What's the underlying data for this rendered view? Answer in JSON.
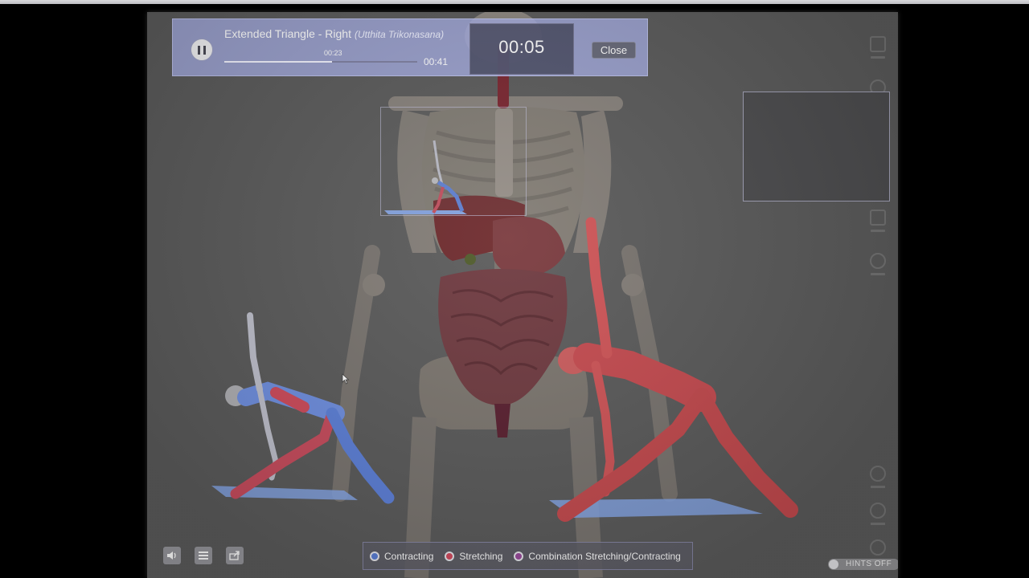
{
  "player": {
    "title": "Extended Triangle - Right",
    "subtitle": "(Utthita Trikonasana)",
    "elapsed": "00:23",
    "total": "00:41",
    "progress_fraction": 0.56,
    "countdown": "00:05",
    "close_label": "Close"
  },
  "legend": {
    "items": [
      {
        "label": "Contracting",
        "color": "#5b7fd6"
      },
      {
        "label": "Stretching",
        "color": "#d34a5e"
      },
      {
        "label": "Combination Stretching/Contracting",
        "color": "#9a4a9c"
      }
    ]
  },
  "hints": {
    "label": "HINTS OFF"
  },
  "icons": {
    "pause": "pause-icon",
    "sound": "speaker-icon",
    "list": "list-icon",
    "export": "export-icon",
    "cursor": "pointer-cursor-icon"
  },
  "colors": {
    "panel": "#aab2eb",
    "muscle_red": "#c94a4f",
    "contract_blue": "#4f6fd0",
    "mat_blue": "#7fa4e8"
  }
}
